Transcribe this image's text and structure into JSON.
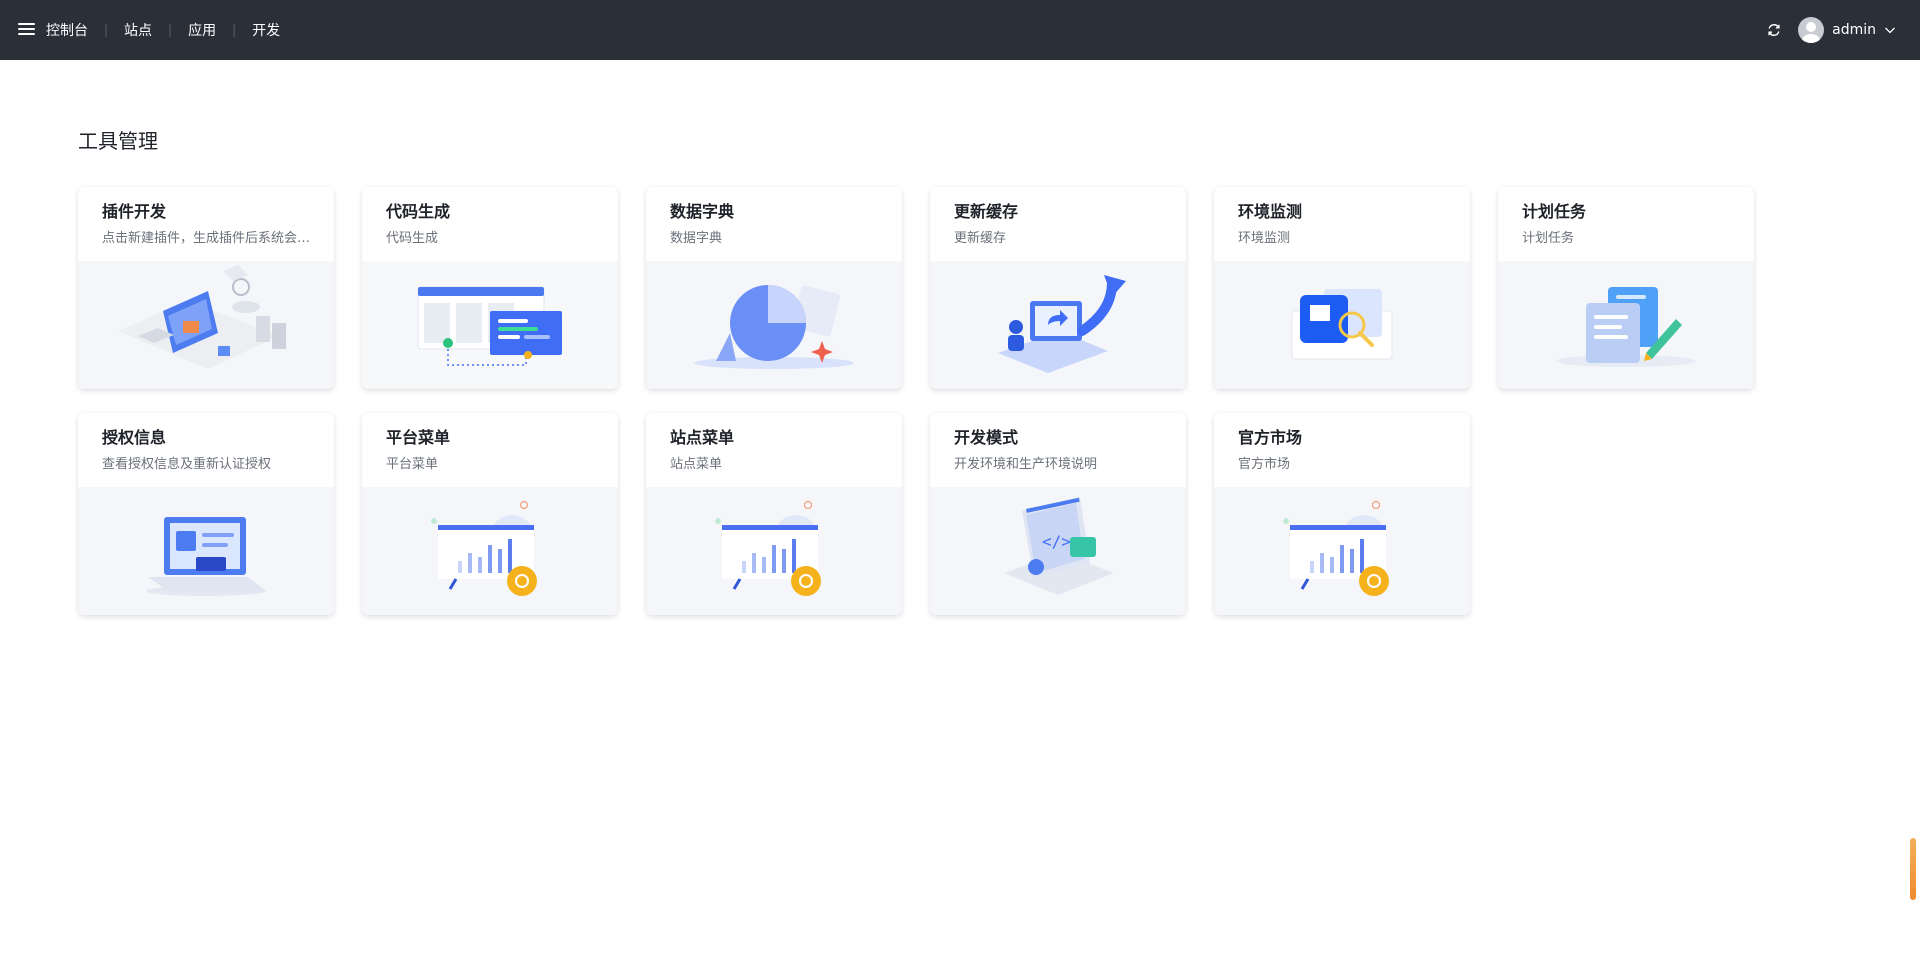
{
  "header": {
    "nav": [
      {
        "label": "控制台"
      },
      {
        "label": "站点"
      },
      {
        "label": "应用"
      },
      {
        "label": "开发"
      }
    ],
    "user": {
      "name": "admin"
    },
    "icons": [
      "menu-icon",
      "refresh-icon",
      "avatar-icon",
      "chevron-down-icon"
    ]
  },
  "main": {
    "title": "工具管理",
    "cards": [
      {
        "title": "插件开发",
        "desc": "点击新建插件，生成插件后系统会…",
        "illustration": "isometric-dev-icon"
      },
      {
        "title": "代码生成",
        "desc": "代码生成",
        "illustration": "code-window-icon"
      },
      {
        "title": "数据字典",
        "desc": "数据字典",
        "illustration": "pie-chart-icon"
      },
      {
        "title": "更新缓存",
        "desc": "更新缓存",
        "illustration": "monitor-arrow-icon"
      },
      {
        "title": "环境监测",
        "desc": "环境监测",
        "illustration": "magnifier-icon"
      },
      {
        "title": "计划任务",
        "desc": "计划任务",
        "illustration": "document-pen-icon"
      },
      {
        "title": "授权信息",
        "desc": "查看授权信息及重新认证授权",
        "illustration": "laptop-icon"
      },
      {
        "title": "平台菜单",
        "desc": "平台菜单",
        "illustration": "bar-board-gear-icon"
      },
      {
        "title": "站点菜单",
        "desc": "站点菜单",
        "illustration": "bar-board-gear-icon"
      },
      {
        "title": "开发模式",
        "desc": "开发环境和生产环境说明",
        "illustration": "code-panel-icon"
      },
      {
        "title": "官方市场",
        "desc": "官方市场",
        "illustration": "bar-board-gear-icon"
      }
    ]
  },
  "colors": {
    "topbar": "#2b2f38",
    "accent": "#3f6df5",
    "gold": "#f5b21d"
  }
}
